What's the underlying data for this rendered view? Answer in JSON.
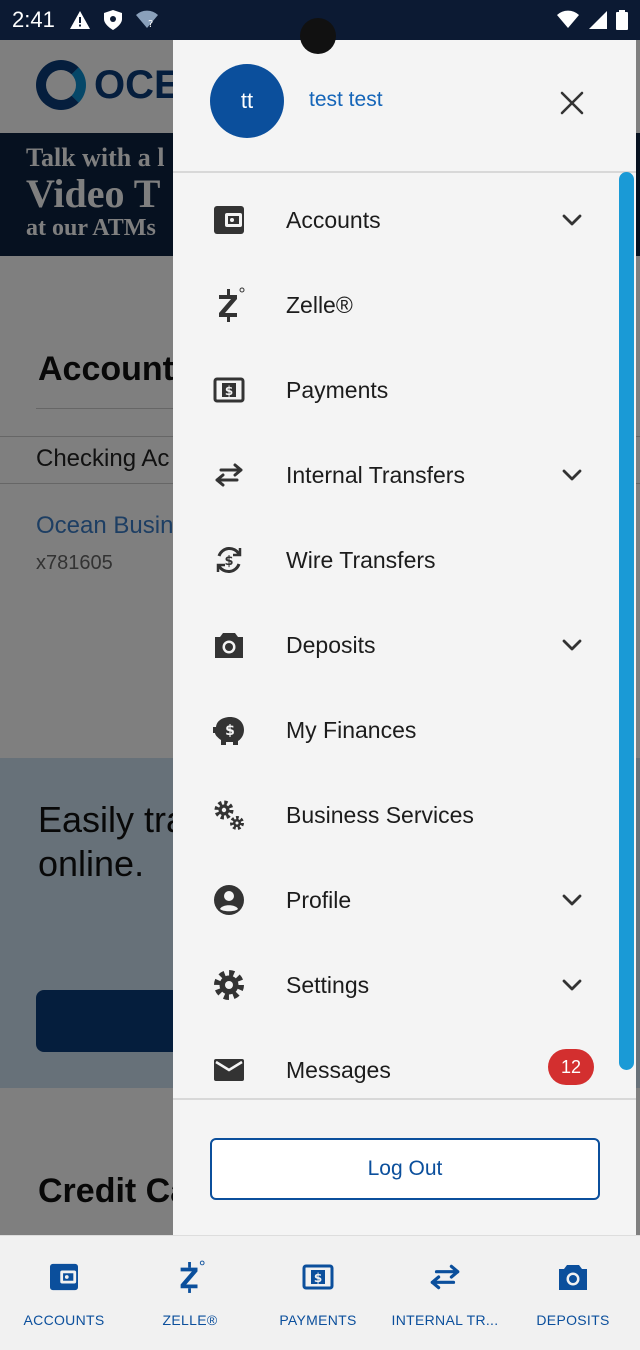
{
  "status_bar": {
    "time": "2:41"
  },
  "background": {
    "logo_text": "OCEA",
    "banner": {
      "line1": "Talk with a l",
      "line2": "Video T",
      "line3": "at our ATMs"
    },
    "section_title": "Account",
    "checking_label": "Checking Ac",
    "account_name": "Ocean Busin",
    "account_number": "x781605",
    "promo_text_line1": "Easily tra",
    "promo_text_line2": "online.",
    "credit_title": "Credit Ca"
  },
  "drawer": {
    "avatar_initials": "tt",
    "user_name": "test test",
    "menu": [
      {
        "label": "Accounts",
        "icon": "wallet-icon",
        "has_chevron": true
      },
      {
        "label": "Zelle®",
        "icon": "zelle-icon",
        "has_chevron": false
      },
      {
        "label": "Payments",
        "icon": "dollar-bill-icon",
        "has_chevron": false
      },
      {
        "label": "Internal Transfers",
        "icon": "transfer-arrows-icon",
        "has_chevron": true
      },
      {
        "label": "Wire Transfers",
        "icon": "currency-exchange-icon",
        "has_chevron": false
      },
      {
        "label": "Deposits",
        "icon": "camera-icon",
        "has_chevron": true
      },
      {
        "label": "My Finances",
        "icon": "piggy-bank-icon",
        "has_chevron": false
      },
      {
        "label": "Business Services",
        "icon": "gears-icon",
        "has_chevron": false
      },
      {
        "label": "Profile",
        "icon": "account-circle-icon",
        "has_chevron": true
      },
      {
        "label": "Settings",
        "icon": "gear-icon",
        "has_chevron": true
      },
      {
        "label": "Messages",
        "icon": "envelope-icon",
        "has_chevron": false,
        "badge": "12"
      }
    ],
    "logout_label": "Log Out"
  },
  "bottom_nav": [
    {
      "label": "ACCOUNTS",
      "icon": "wallet-icon"
    },
    {
      "label": "ZELLE®",
      "icon": "zelle-icon"
    },
    {
      "label": "PAYMENTS",
      "icon": "dollar-bill-icon"
    },
    {
      "label": "INTERNAL TR...",
      "icon": "transfer-arrows-icon"
    },
    {
      "label": "DEPOSITS",
      "icon": "camera-icon"
    }
  ],
  "colors": {
    "brand_blue": "#0b4f9c",
    "scrollbar": "#1a9ad6",
    "badge_red": "#d32f2f",
    "status_bar": "#0c1a33"
  }
}
